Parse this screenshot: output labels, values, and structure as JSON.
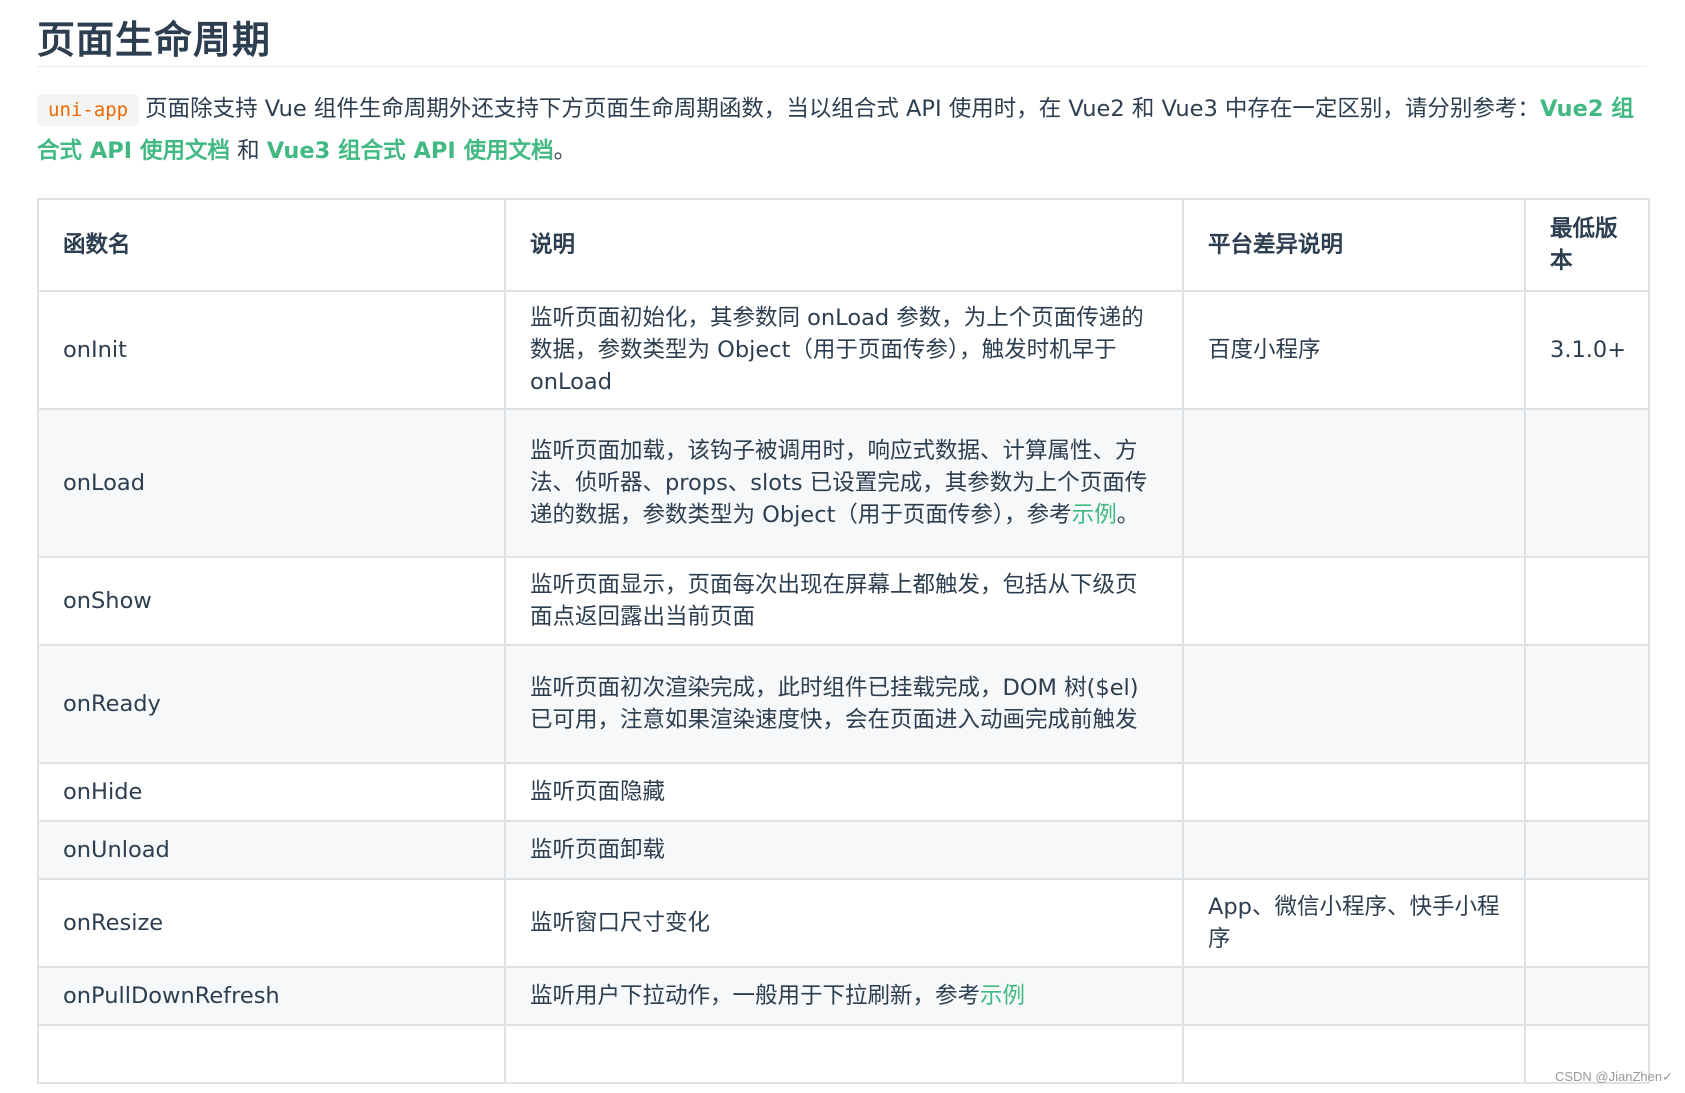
{
  "page": {
    "title": "页面生命周期"
  },
  "intro": {
    "code": "uni-app",
    "text_before": "页面除支持 Vue 组件生命周期外还支持下方页面生命周期函数，当以组合式 API 使用时，在 Vue2 和 Vue3 中存在一定区别，请分别参考：",
    "link_vue2": "Vue2 组合式 API 使用文档",
    "text_middle": " 和 ",
    "link_vue3": "Vue3 组合式 API 使用文档",
    "text_after": "。"
  },
  "table": {
    "headers": [
      "函数名",
      "说明",
      "平台差异说明",
      "最低版本"
    ],
    "rows": [
      {
        "name": "onInit",
        "desc": "监听页面初始化，其参数同 onLoad 参数，为上个页面传递的数据，参数类型为 Object（用于页面传参），触发时机早于 onLoad",
        "platform": "百度小程序",
        "version": "3.1.0+"
      },
      {
        "name": "onLoad",
        "desc": "监听页面加载，该钩子被调用时，响应式数据、计算属性、方法、侦听器、props、slots 已设置完成，其参数为上个页面传递的数据，参数类型为 Object（用于页面传参），参考",
        "desc_link": "示例",
        "desc_suffix": "。",
        "platform": "",
        "version": ""
      },
      {
        "name": "onShow",
        "desc": "监听页面显示，页面每次出现在屏幕上都触发，包括从下级页面点返回露出当前页面",
        "platform": "",
        "version": ""
      },
      {
        "name": "onReady",
        "desc": "监听页面初次渲染完成，此时组件已挂载完成，DOM 树($el)已可用，注意如果渲染速度快，会在页面进入动画完成前触发",
        "platform": "",
        "version": ""
      },
      {
        "name": "onHide",
        "desc": "监听页面隐藏",
        "platform": "",
        "version": ""
      },
      {
        "name": "onUnload",
        "desc": "监听页面卸载",
        "platform": "",
        "version": ""
      },
      {
        "name": "onResize",
        "desc": "监听窗口尺寸变化",
        "platform": "App、微信小程序、快手小程序",
        "version": ""
      },
      {
        "name": "onPullDownRefresh",
        "desc": "监听用户下拉动作，一般用于下拉刷新，参考",
        "desc_link": "示例",
        "platform": "",
        "version": ""
      }
    ]
  },
  "watermark": "CSDN @JianZhen✓"
}
